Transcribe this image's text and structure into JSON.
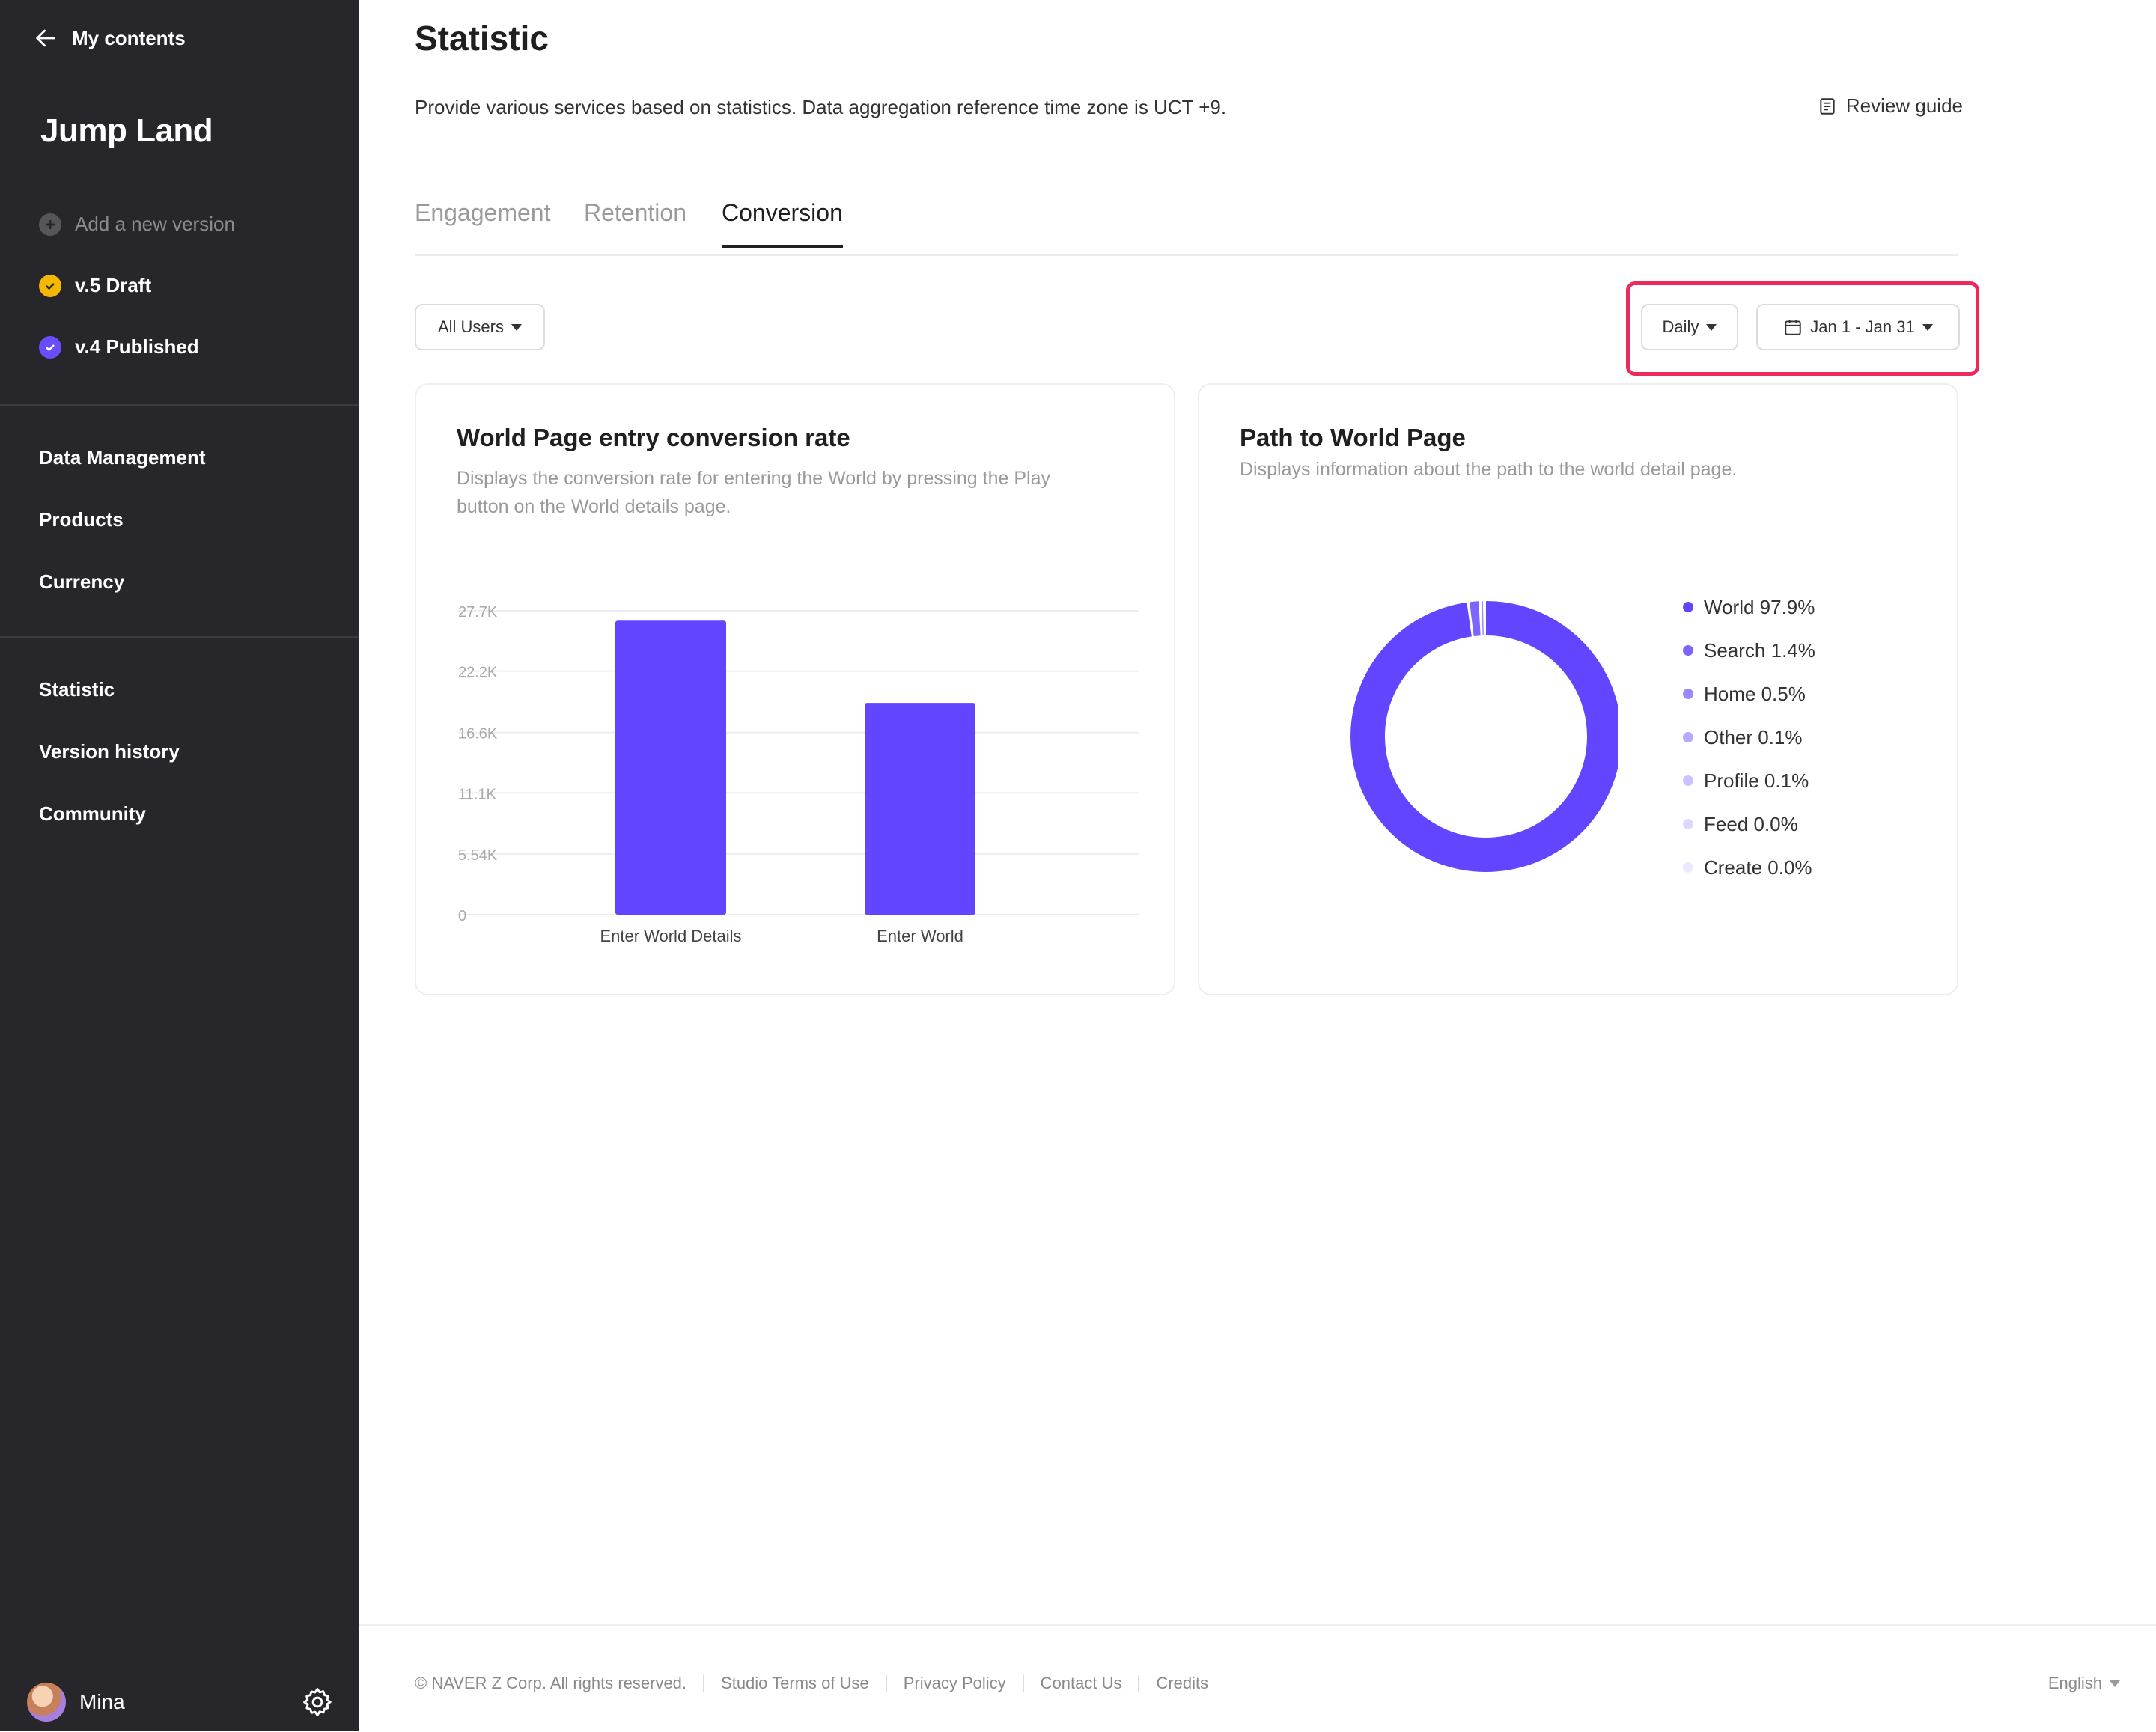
{
  "sidebar": {
    "back_label": "My contents",
    "app_title": "Jump Land",
    "add_version_label": "Add a new version",
    "versions": [
      {
        "label": "v.5 Draft",
        "color": "#f5b800"
      },
      {
        "label": "v.4 Published",
        "color": "#6a4dff"
      }
    ],
    "nav_group1": [
      "Data Management",
      "Products",
      "Currency"
    ],
    "nav_group2": [
      "Statistic",
      "Version history",
      "Community"
    ],
    "user_name": "Mina"
  },
  "header": {
    "title": "Statistic",
    "description": "Provide various services based on statistics. Data aggregation reference time zone is UCT +9.",
    "review_guide": "Review guide"
  },
  "tabs": [
    {
      "label": "Engagement",
      "active": false
    },
    {
      "label": "Retention",
      "active": false
    },
    {
      "label": "Conversion",
      "active": true
    }
  ],
  "filters": {
    "user_filter": "All Users",
    "interval": "Daily",
    "date_range": "Jan 1 - Jan 31"
  },
  "cards": {
    "conversion": {
      "title": "World Page entry conversion rate",
      "description_line1": "Displays the conversion rate for entering the World by pressing the Play",
      "description_line2": "button on the World details page."
    },
    "path": {
      "title": "Path to World Page",
      "description": "Displays information about the path to the world detail page."
    }
  },
  "chart_data": [
    {
      "type": "bar",
      "categories": [
        "Enter World Details",
        "Enter World"
      ],
      "values": [
        26800,
        19300
      ],
      "yticks": [
        "0",
        "5.54K",
        "11.1K",
        "16.6K",
        "22.2K",
        "27.7K"
      ],
      "ytick_values": [
        0,
        5540,
        11100,
        16600,
        22200,
        27700
      ],
      "ylim": [
        0,
        27700
      ],
      "grid": true,
      "color": "#6245ff"
    },
    {
      "type": "pie",
      "donut": true,
      "labels": [
        "World",
        "Search",
        "Home",
        "Other",
        "Profile",
        "Feed",
        "Create"
      ],
      "values": [
        97.9,
        1.4,
        0.5,
        0.1,
        0.1,
        0.0,
        0.0
      ],
      "value_labels": [
        "97.9%",
        "1.4%",
        "0.5%",
        "0.1%",
        "0.1%",
        "0.0%",
        "0.0%"
      ],
      "colors": [
        "#6245ff",
        "#7d66ff",
        "#9a8aff",
        "#b5aaff",
        "#cbc3ff",
        "#ddd8ff",
        "#ece9ff"
      ],
      "legend": "right"
    }
  ],
  "footer": {
    "links": [
      "© NAVER Z Corp. All rights reserved.",
      "Studio Terms of Use",
      "Privacy Policy",
      "Contact Us",
      "Credits"
    ],
    "language": "English"
  }
}
